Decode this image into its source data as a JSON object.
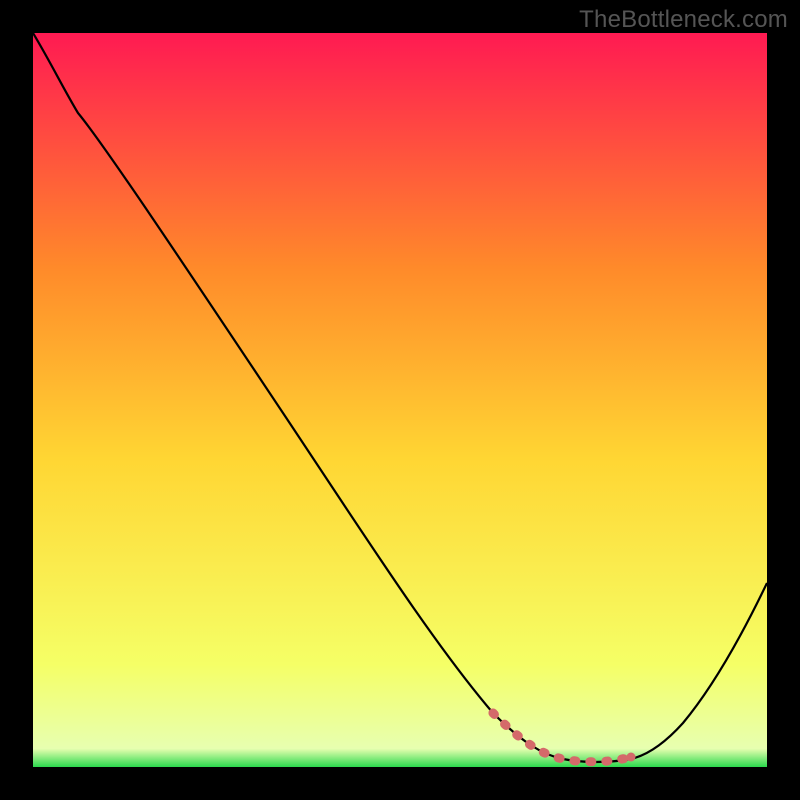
{
  "watermark": "TheBottleneck.com",
  "colors": {
    "black": "#000000",
    "gradient_top": "#ff1a52",
    "gradient_upper_mid": "#ff8a2a",
    "gradient_mid": "#ffd633",
    "gradient_lower_mid": "#f5ff66",
    "gradient_bottom": "#2bd94d",
    "curve": "#000000",
    "highlight": "#d46a6a"
  },
  "chart_data": {
    "type": "line",
    "title": "",
    "xlabel": "",
    "ylabel": "",
    "xlim": [
      0,
      100
    ],
    "ylim": [
      0,
      100
    ],
    "grid": false,
    "series": [
      {
        "name": "bottleneck-curve",
        "x": [
          0,
          4,
          8,
          12,
          16,
          20,
          24,
          28,
          32,
          36,
          40,
          44,
          48,
          52,
          56,
          60,
          62,
          64,
          66,
          68,
          70,
          72,
          74,
          76,
          78,
          80,
          82,
          84,
          86,
          88,
          90,
          92,
          94,
          96,
          98,
          100
        ],
        "y": [
          100,
          96,
          93,
          88,
          82,
          76,
          70,
          64,
          58,
          52,
          46,
          40,
          34,
          28,
          22,
          16,
          13,
          10,
          8,
          6,
          4,
          2.5,
          1.5,
          1,
          0.8,
          0.8,
          1,
          2,
          4,
          7,
          11,
          15,
          19,
          24,
          29,
          34
        ]
      }
    ],
    "annotations": [
      {
        "name": "optimal-range-highlight",
        "x_start": 62,
        "x_end": 82,
        "style": "dotted-red"
      }
    ]
  }
}
